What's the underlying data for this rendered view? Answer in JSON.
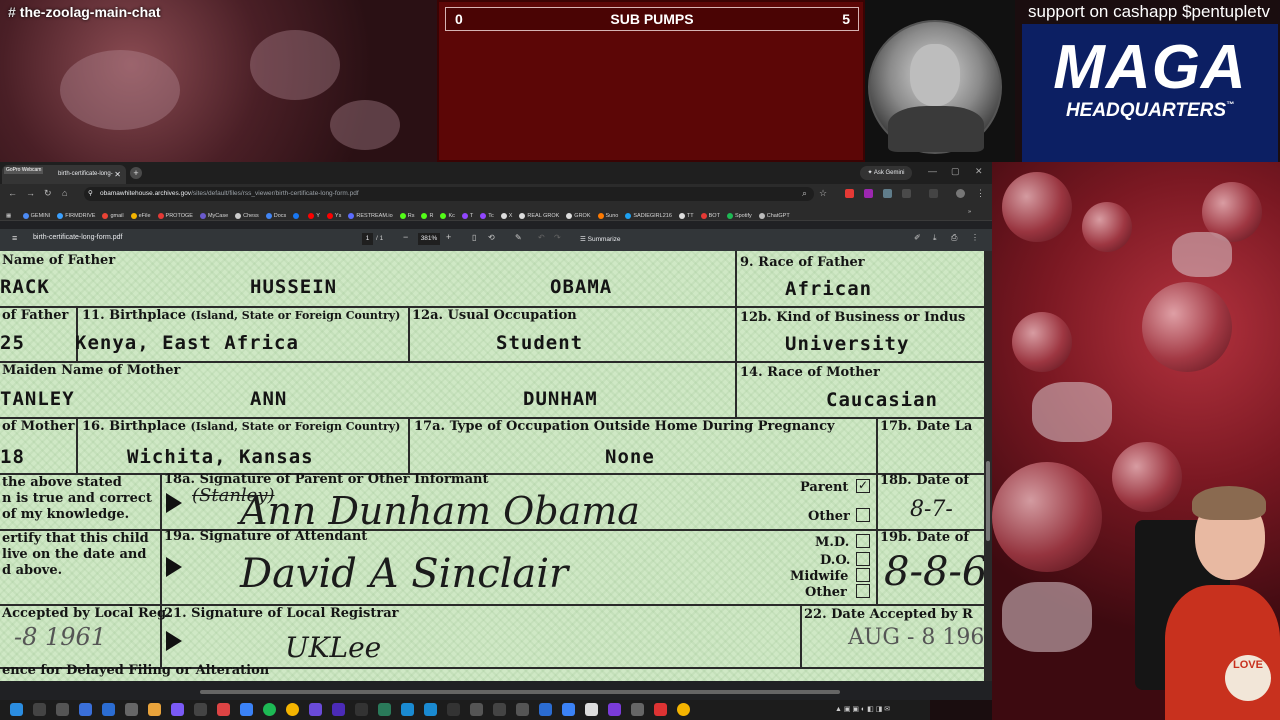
{
  "overlay": {
    "chat_channel": "the-zoolag-main-chat",
    "sub_pumps": {
      "left": "0",
      "label": "SUB PUMPS",
      "right": "5"
    },
    "support_text": "support on cashapp $pentupletv",
    "maga_title": "MAGA",
    "maga_subtitle": "HEADQUARTERS",
    "tm": "™",
    "webcam_label": "GoPro Webcam",
    "shirt_text": "LOVE"
  },
  "browser": {
    "tab_title": "birth-certificate-long-form.pdf",
    "ask_gemini": "Ask Gemini",
    "url_domain": "obamawhitehouse.archives.gov",
    "url_path": "/sites/default/files/rss_viewer/birth-certificate-long-form.pdf",
    "bookmarks": [
      {
        "label": "GEMINI",
        "color": "#4c8bf5"
      },
      {
        "label": "FIRMDRIVE",
        "color": "#3aa0ff"
      },
      {
        "label": "gmail",
        "color": "#ea4335"
      },
      {
        "label": "eFile",
        "color": "#f4b400"
      },
      {
        "label": "PROTOGE",
        "color": "#e53935"
      },
      {
        "label": "MyCase",
        "color": "#6a5acd"
      },
      {
        "label": "Chess",
        "color": "#cccccc"
      },
      {
        "label": "Docs",
        "color": "#4285f4"
      },
      {
        "label": "",
        "color": "#1877f2"
      },
      {
        "label": "Y",
        "color": "#ff0000"
      },
      {
        "label": "Ys",
        "color": "#ff0000"
      },
      {
        "label": "RESTREAM.io",
        "color": "#5b6cff"
      },
      {
        "label": "Rs",
        "color": "#53fc18"
      },
      {
        "label": "R",
        "color": "#53fc18"
      },
      {
        "label": "Kc",
        "color": "#53fc18"
      },
      {
        "label": "T",
        "color": "#9146ff"
      },
      {
        "label": "Tc",
        "color": "#9146ff"
      },
      {
        "label": "X",
        "color": "#dddddd"
      },
      {
        "label": "REAL GROK",
        "color": "#dddddd"
      },
      {
        "label": "GROK",
        "color": "#dddddd"
      },
      {
        "label": "Suno",
        "color": "#ff7a00"
      },
      {
        "label": "SADIEGIRL216",
        "color": "#1da1f2"
      },
      {
        "label": "TT",
        "color": "#dddddd"
      },
      {
        "label": "BOT",
        "color": "#e53935"
      },
      {
        "label": "Spotify",
        "color": "#1db954"
      },
      {
        "label": "ChatGPT",
        "color": "#bbbbbb"
      }
    ],
    "pdf": {
      "file_name": "birth-certificate-long-form.pdf",
      "page": "1",
      "page_count": "/ 1",
      "zoom": "381%",
      "summarize": "Summarize"
    }
  },
  "document": {
    "row1": {
      "label_name_father": "Name of Father",
      "father_first": "RACK",
      "father_middle": "HUSSEIN",
      "father_last": "OBAMA",
      "label_race_father": "9. Race of Father",
      "race_father": "African"
    },
    "row2": {
      "label_age_father": "of Father",
      "age_father": "25",
      "label_birthplace": "11. Birthplace",
      "label_birthplace_hint": "(Island, State or Foreign Country)",
      "birthplace_father": "Kenya, East Africa",
      "label_occupation": "12a. Usual Occupation",
      "occupation": "Student",
      "label_business": "12b. Kind of Business or Indus",
      "business": "University"
    },
    "row3": {
      "label_maiden": "Maiden Name of Mother",
      "mother_last_fragment": "TANLEY",
      "mother_first": "ANN",
      "mother_middle": "DUNHAM",
      "label_race_mother": "14. Race of Mother",
      "race_mother": "Caucasian"
    },
    "row4": {
      "label_age_mother": "of Mother",
      "age_mother": "18",
      "label_birthplace_mother": "16. Birthplace",
      "label_birthplace_mother_hint": "(Island, State or Foreign Country)",
      "birthplace_mother": "Wichita, Kansas",
      "label_occ_mother": "17a. Type of Occupation Outside Home During Pregnancy",
      "occ_mother": "None",
      "label_date_last": "17b. Date La"
    },
    "row5": {
      "cert_text": [
        "the above stated",
        "n is true and correct",
        "of my knowledge."
      ],
      "label_sig_parent": "18a. Signature of Parent or Other Informant",
      "sig_parent": "Ann Dunham Obama",
      "struck_text": "(Stanley)",
      "parent": "Parent",
      "other": "Other",
      "checkmark": "✓",
      "label_date_of": "18b. Date of",
      "date_18b": "8-7-"
    },
    "row6": {
      "cert_text": [
        "ertify that this child",
        "live on the date and",
        "d above."
      ],
      "label_sig_attendant": "19a. Signature of Attendant",
      "sig_attendant": "David A Sinclair",
      "md": "M.D.",
      "do": "D.O.",
      "midwife": "Midwife",
      "other": "Other",
      "label_date_of": "19b. Date of",
      "date_19b": "8-8-6"
    },
    "row7": {
      "label_accepted": "Accepted by Local Reg.",
      "accepted_date": "-8 1961",
      "label_sig_registrar": "21. Signature of Local Registrar",
      "sig_registrar": "UKLee",
      "label_accepted_by": "22. Date Accepted by R",
      "date_22": "AUG - 8 196"
    },
    "row8": {
      "label_delayed": "ence for Delayed Filing or Alteration"
    }
  }
}
